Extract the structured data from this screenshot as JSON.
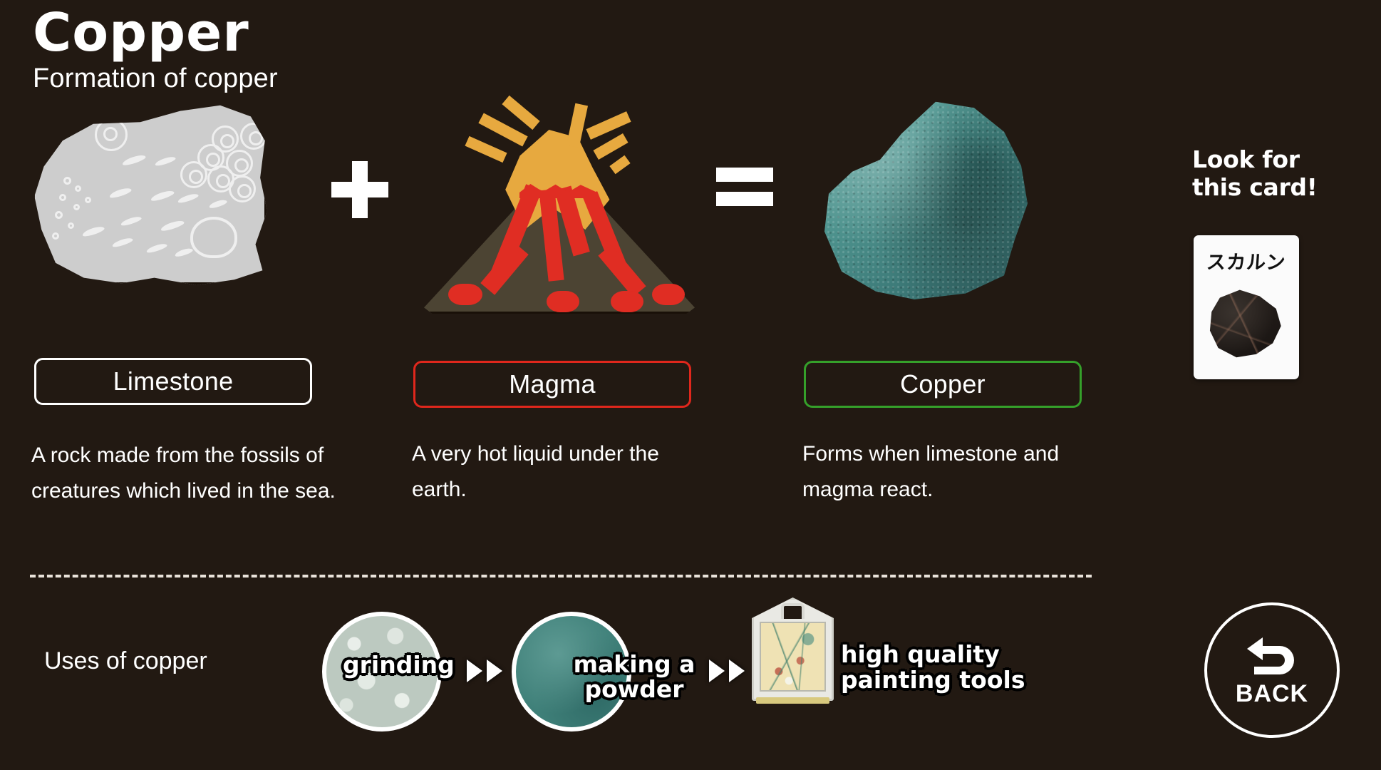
{
  "header": {
    "title": "Copper",
    "subtitle": "Formation of copper"
  },
  "equation": {
    "plus_symbol": "+",
    "equals_symbol": "=",
    "items": [
      {
        "art": "limestone-rock-illustration",
        "label": "Limestone",
        "border_color": "#ffffff",
        "description": "A rock made from the fossils of creatures which lived in the sea."
      },
      {
        "art": "volcano-illustration",
        "label": "Magma",
        "border_color": "#e0271c",
        "description": "A very hot liquid under the earth."
      },
      {
        "art": "copper-ore-photo",
        "label": "Copper",
        "border_color": "#35a02a",
        "description": "Forms when limestone and magma react."
      }
    ]
  },
  "look_for_card": {
    "title_line1": "Look for",
    "title_line2": "this card!",
    "card_title": "スカルン",
    "card_image": "dark-skarn-rock"
  },
  "uses": {
    "label": "Uses of copper",
    "steps": [
      {
        "image": "crushed-rock-circle",
        "label": "grinding"
      },
      {
        "image": "teal-powder-circle",
        "label_line1": "making a",
        "label_line2": "powder"
      },
      {
        "image": "framed-botanical-painting",
        "label_line1": "high quality",
        "label_line2": "painting tools"
      }
    ],
    "arrow_symbol": "▶▶"
  },
  "back_button": {
    "label": "BACK",
    "icon": "u-turn-arrow-icon"
  },
  "colors": {
    "background": "#221912",
    "text": "#ffffff",
    "magma_accent": "#e0271c",
    "copper_accent": "#35a02a",
    "lava_orange": "#e7a93f",
    "lava_red": "#e02d23",
    "mountain": "#4c4433",
    "limestone_gray": "#cdcdcd",
    "copper_teal": "#4e938e"
  }
}
